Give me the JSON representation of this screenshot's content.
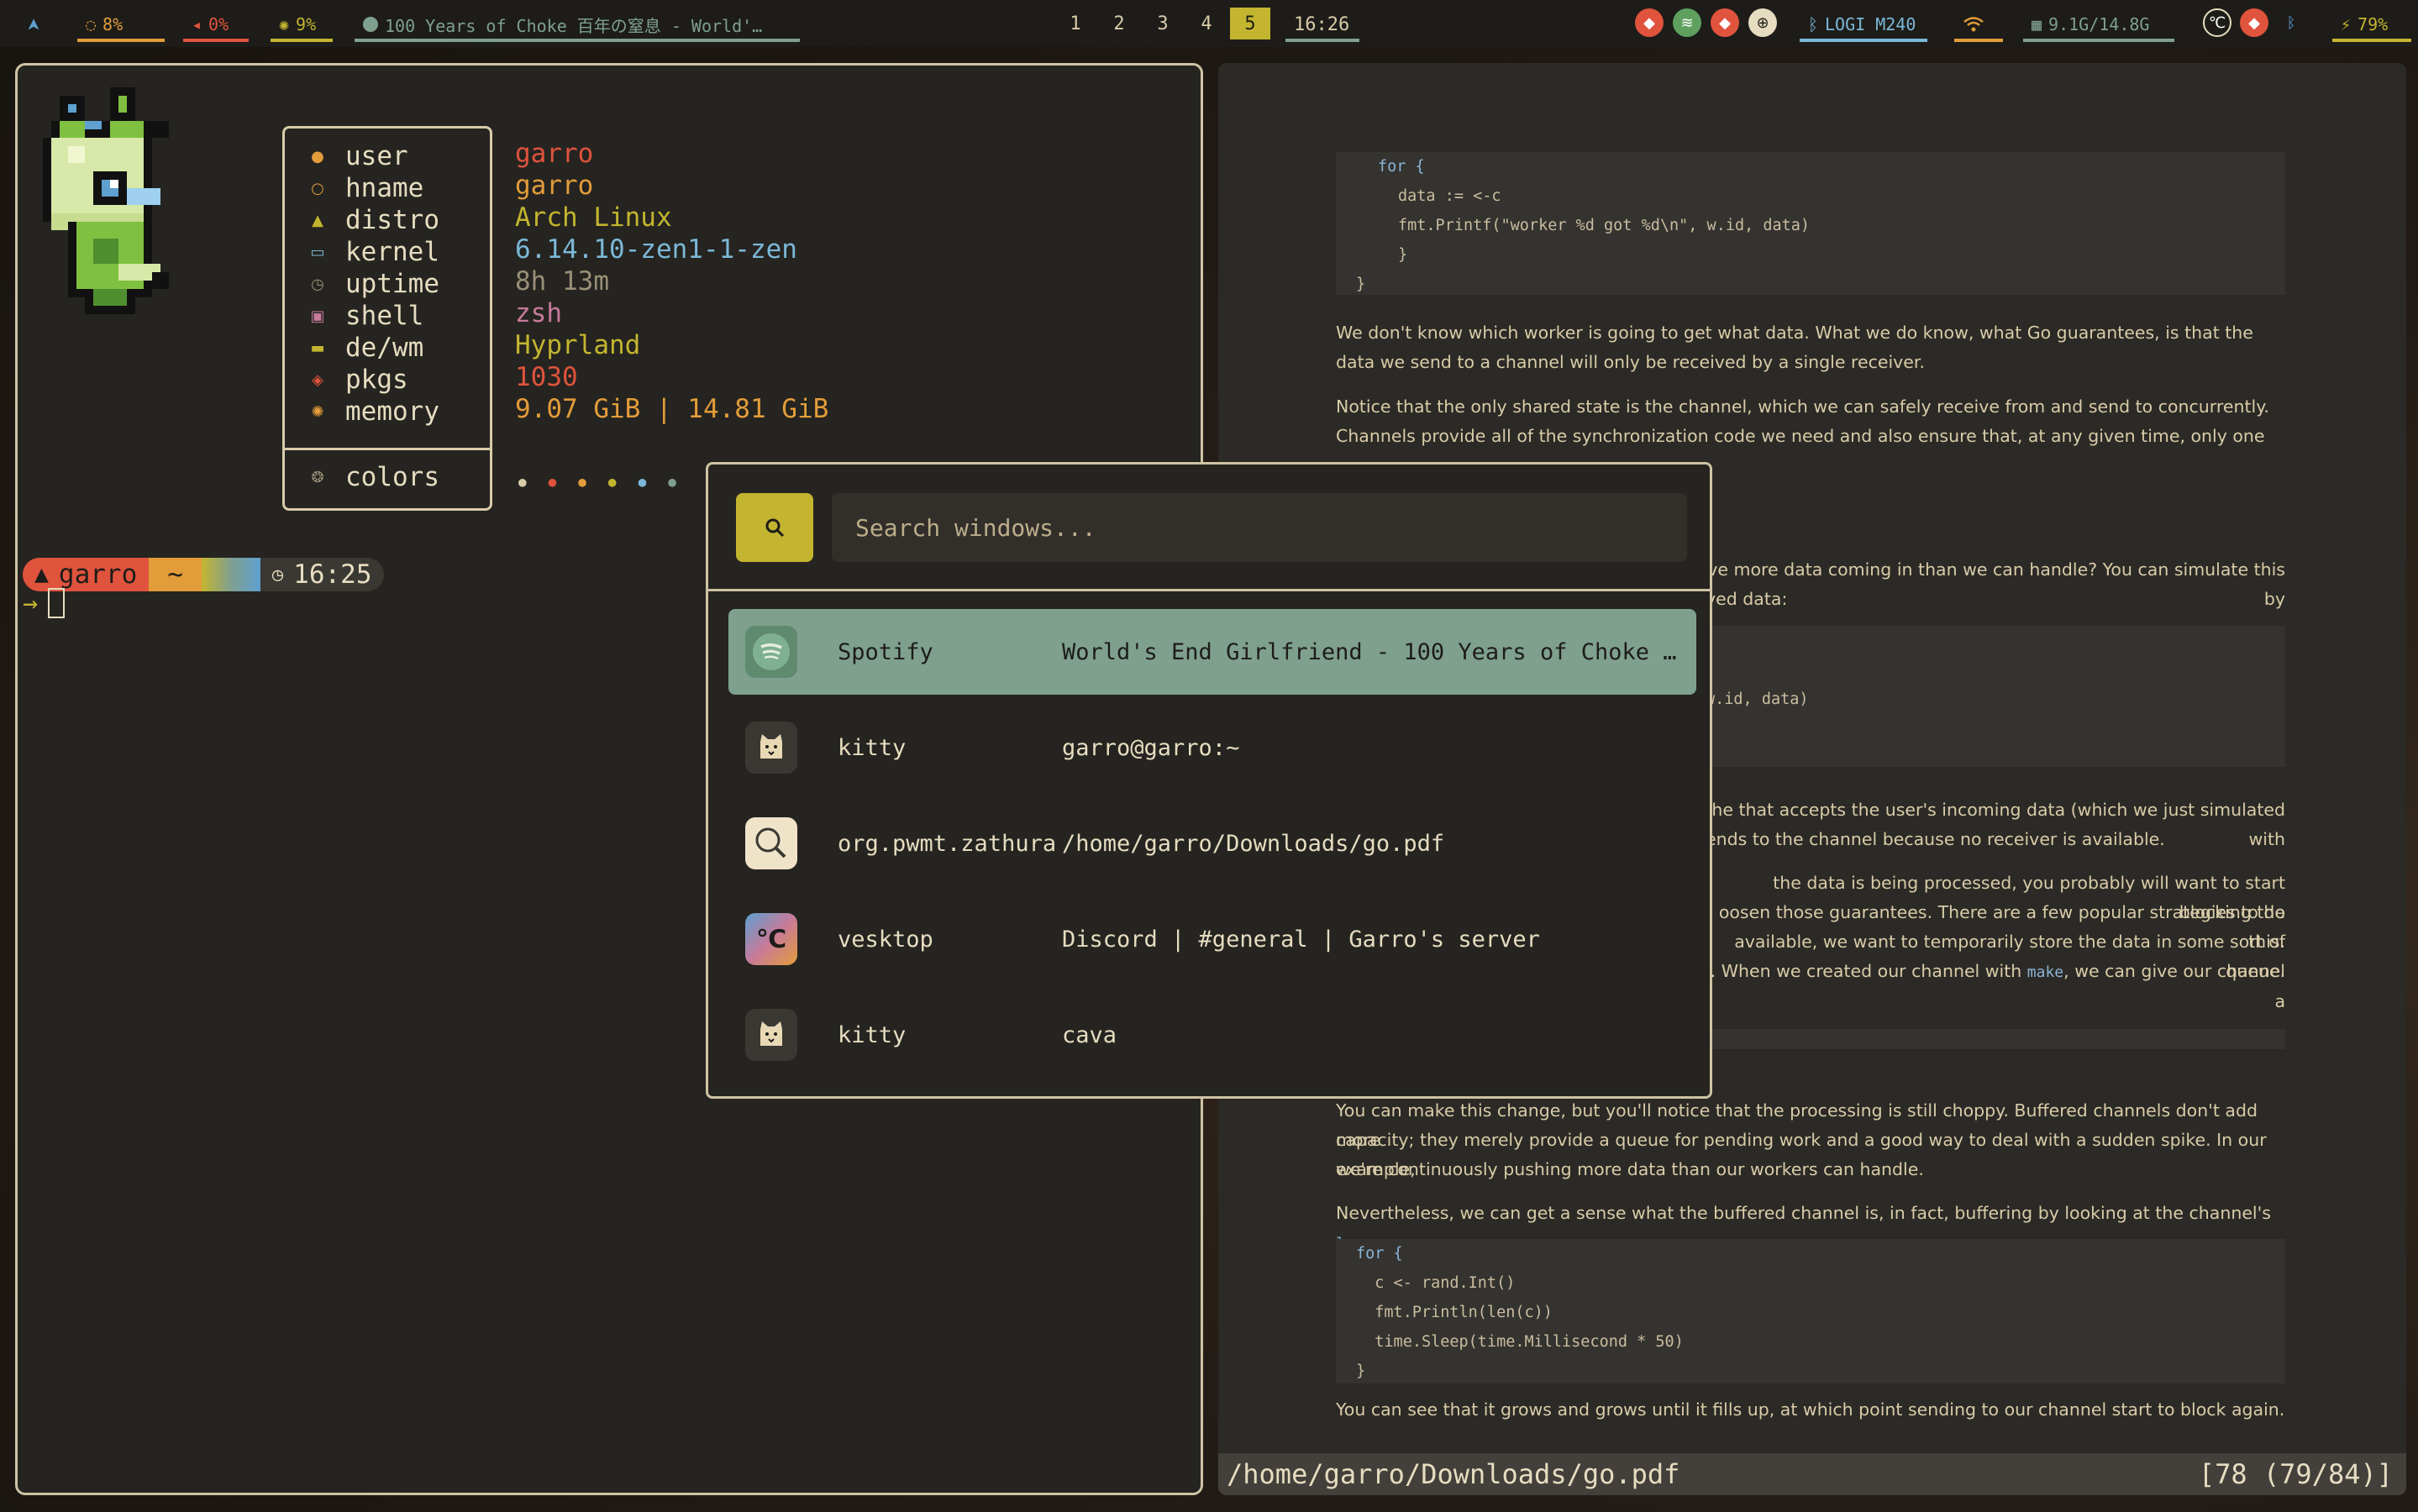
{
  "topbar": {
    "logo": "arch-icon",
    "brightness": "8%",
    "volume": "0%",
    "cpu": "9%",
    "media": "100 Years of Choke 百年の窒息 - World'…",
    "workspaces": [
      "1",
      "2",
      "3",
      "4",
      "5"
    ],
    "active_workspace": "5",
    "clock": "16:26",
    "bluetooth_device": "LOGI M240",
    "memory": "9.1G/14.8G",
    "battery": "79%"
  },
  "terminal": {
    "info_labels": [
      {
        "icon": "user-icon",
        "label": "user"
      },
      {
        "icon": "host-icon",
        "label": "hname"
      },
      {
        "icon": "arch-icon",
        "label": "distro"
      },
      {
        "icon": "laptop-icon",
        "label": "kernel"
      },
      {
        "icon": "clock-icon",
        "label": "uptime"
      },
      {
        "icon": "terminal-icon",
        "label": "shell"
      },
      {
        "icon": "monitor-icon",
        "label": "de/wm"
      },
      {
        "icon": "package-icon",
        "label": "pkgs"
      },
      {
        "icon": "memory-icon",
        "label": "memory"
      }
    ],
    "colors_label": "colors",
    "info_values": [
      "garro",
      "garro",
      "Arch Linux",
      "6.14.10-zen1-1-zen",
      "8h 13m",
      "zsh",
      "Hyprland",
      "1030",
      "9.07 GiB | 14.81 GiB"
    ],
    "prompt": {
      "user": "garro",
      "dir": "~",
      "time": "16:25",
      "arrow": "→"
    }
  },
  "launcher": {
    "search_placeholder": "Search windows...",
    "rows": [
      {
        "app": "Spotify",
        "title": "World's End Girlfriend - 100 Years of Choke …",
        "icon": "spotify-icon"
      },
      {
        "app": "kitty",
        "title": "garro@garro:~",
        "icon": "kitty-icon"
      },
      {
        "app": "org.pwmt.zathura",
        "title": "/home/garro/Downloads/go.pdf",
        "icon": "zathura-icon"
      },
      {
        "app": "vesktop",
        "title": "Discord | #general | Garro's server",
        "icon": "vesktop-icon"
      },
      {
        "app": "kitty",
        "title": "cava",
        "icon": "kitty-icon"
      }
    ]
  },
  "zathura": {
    "code1": [
      "for {",
      "  data := <-c",
      "  fmt.Printf(\"worker %d got %d\\n\", w.id, data)",
      "}",
      "}"
    ],
    "p1": "We don't know which worker is going to get what data.  What we do know, what Go guarantees, is that the data we send to a channel will only be received by a single receiver.",
    "p2": "Notice that the only shared state is the channel, which we can safely receive from and send to concurrently. Channels provide all of the synchronization code we need and also ensure that, at any given time, only one goroutine has access",
    "p3a": "ve more data coming in than we can handle?  You can simulate this by",
    "p3b": "yed data:",
    "code2": [
      "w.id, data)",
      ")"
    ],
    "p4a": "he that accepts the user's incoming data (which we just simulated with",
    "p4b": "ends to the channel because no receiver is available.",
    "p5a": "the data is being processed, you probably will want to start blocking the",
    "p5b": "oosen those guarantees.  There are a few popular strategies to do this.",
    "p5c": "available, we want to temporarily store the data in some sort of queue.",
    "p5d": ".  When we created our channel with",
    "p5d_code": "make",
    "p5d_end": ", we can give our channel a",
    "p6a": "You can make this change, but you'll notice that the processing is still choppy.  Buffered channels don't add more",
    "p6b": "capacity; they merely provide a queue for pending work and a good way to deal with a sudden spike. In our example,",
    "p6c": "we're continuously pushing more data than our workers can handle.",
    "p7": "Nevertheless, we can get a sense what the buffered channel is, in fact, buffering by looking at the channel's",
    "p7_code": "len",
    "code3": [
      "for {",
      "  c <- rand.Int()",
      "  fmt.Println(len(c))",
      "  time.Sleep(time.Millisecond * 50)",
      "}"
    ],
    "p8": "You can see that it grows and grows until it fills up, at which point sending to our channel start to block again.",
    "status_path": "/home/garro/Downloads/go.pdf",
    "status_page": "[78 (79/84)]"
  },
  "colors": {
    "accent": "#c4b530",
    "selected_row": "#7fa08f",
    "border": "#cfc3a4",
    "red": "#e0533d",
    "orange": "#e39c3a",
    "yellow": "#c4b530",
    "blue": "#7cb8d8",
    "green": "#7fa08f"
  }
}
